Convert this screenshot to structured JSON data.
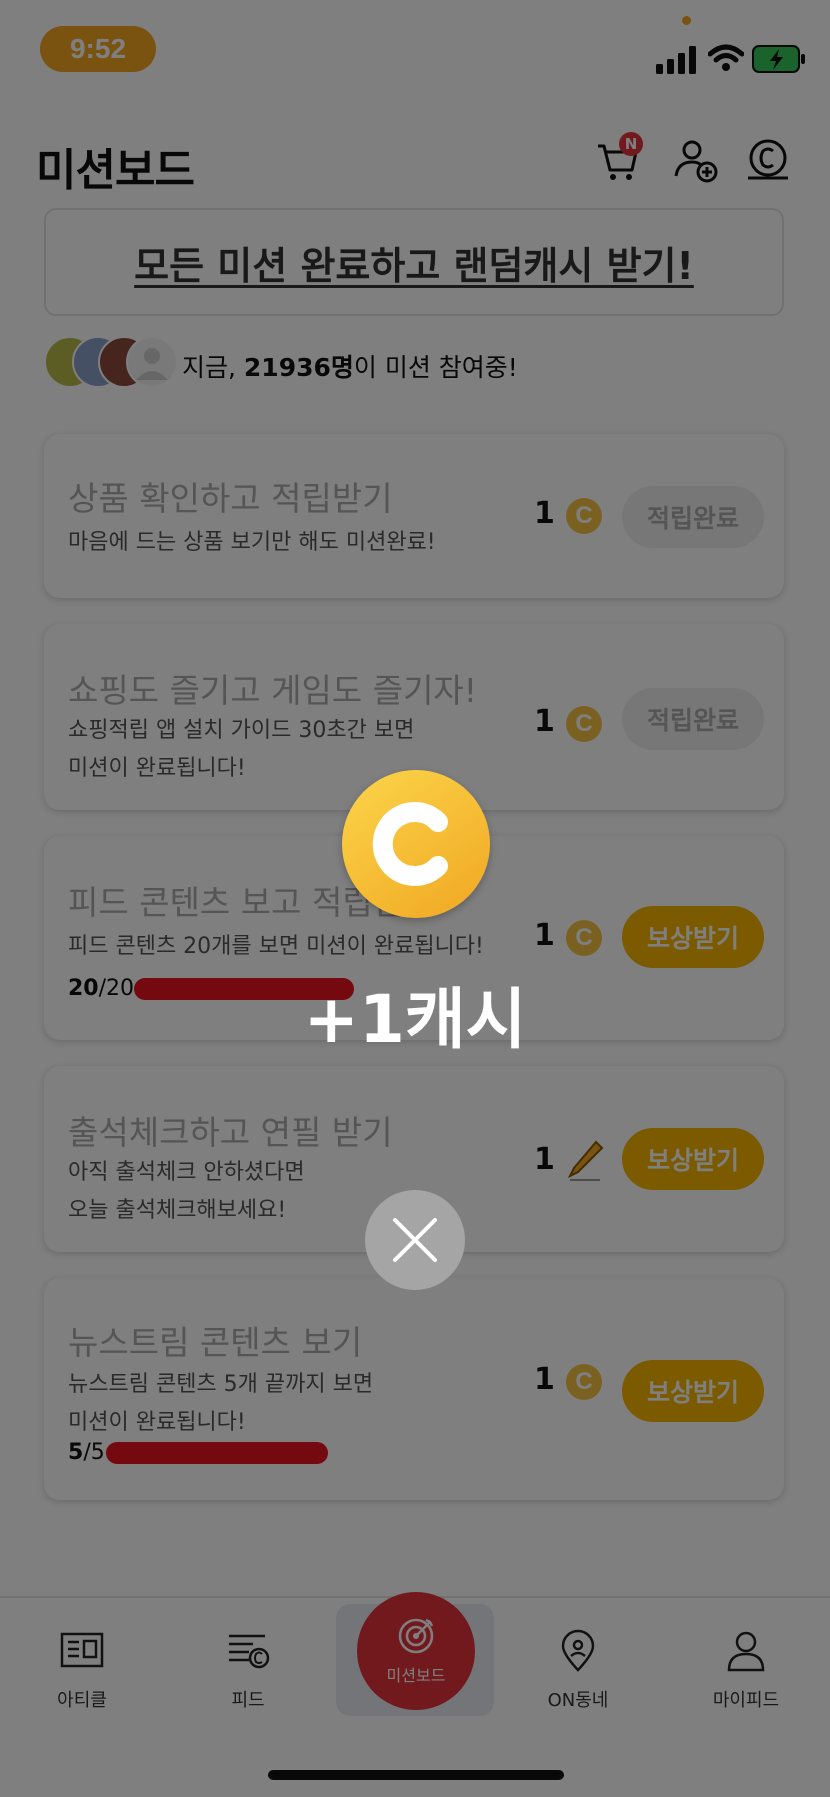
{
  "status_bar": {
    "time": "9:52"
  },
  "header": {
    "title": "미션보드",
    "cart_badge": "N"
  },
  "banner": {
    "text": "모든 미션 완료하고 랜덤캐시 받기!"
  },
  "participants": {
    "prefix": "지금, ",
    "count": "21936명",
    "suffix": "이 미션 참여중!"
  },
  "missions": [
    {
      "title": "상품 확인하고 적립받기",
      "desc": "마음에 드는 상품 보기만 해도 미션완료!",
      "amount": "1",
      "reward_icon": "coin-icon",
      "button": "적립완료",
      "state": "done"
    },
    {
      "title": "쇼핑도 즐기고 게임도 즐기자!",
      "desc": "쇼핑적립 앱 설치 가이드 30초간 보면\n미션이 완료됩니다!",
      "amount": "1",
      "reward_icon": "coin-icon",
      "button": "적립완료",
      "state": "done"
    },
    {
      "title": "피드 콘텐츠 보고 적립받기",
      "desc": "피드 콘텐츠 20개를 보면 미션이 완료됩니다!",
      "amount": "1",
      "reward_icon": "coin-icon",
      "button": "보상받기",
      "state": "claim",
      "progress_current": "20",
      "progress_total": "/20"
    },
    {
      "title": "출석체크하고 연필 받기",
      "desc": "아직 출석체크 안하셨다면\n오늘 출석체크해보세요!",
      "amount": "1",
      "reward_icon": "pencil-icon",
      "button": "보상받기",
      "state": "claim"
    },
    {
      "title": "뉴스트림 콘텐츠 보기",
      "desc": "뉴스트림 콘텐츠 5개 끝까지 보면\n미션이 완료됩니다!",
      "amount": "1",
      "reward_icon": "coin-icon",
      "button": "보상받기",
      "state": "claim",
      "progress_current": "5",
      "progress_total": "/5"
    }
  ],
  "tabs": [
    {
      "label": "아티클",
      "icon": "article-icon"
    },
    {
      "label": "피드",
      "icon": "feed-icon"
    },
    {
      "label": "미션보드",
      "icon": "target-icon",
      "active": true
    },
    {
      "label": "ON동네",
      "icon": "location-pin-icon"
    },
    {
      "label": "마이피드",
      "icon": "person-icon"
    }
  ],
  "popup": {
    "reward_text": "+1캐시"
  },
  "colors": {
    "accent": "#e5333d",
    "coin": "#f5c342",
    "claim_button": "#f7b500",
    "progress": "#e8141e"
  }
}
